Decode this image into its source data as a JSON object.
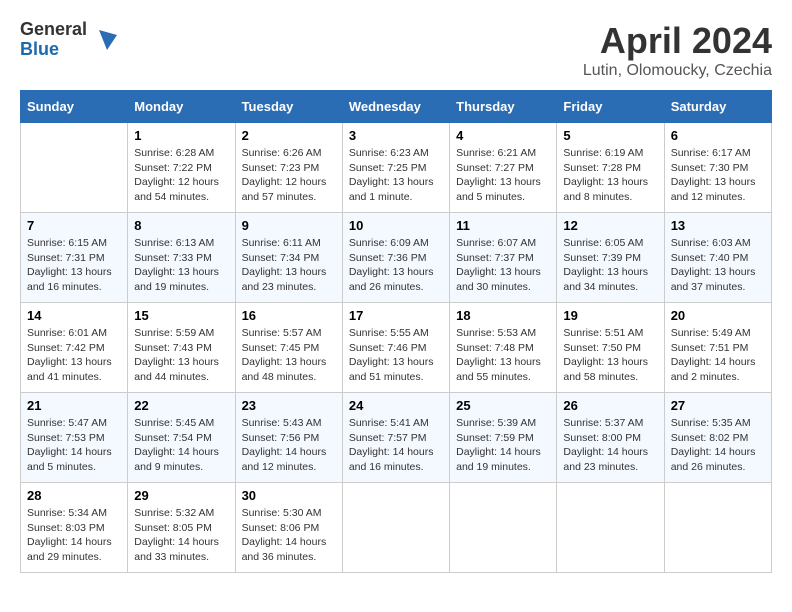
{
  "header": {
    "logo_general": "General",
    "logo_blue": "Blue",
    "month_title": "April 2024",
    "subtitle": "Lutin, Olomoucky, Czechia"
  },
  "calendar": {
    "days_of_week": [
      "Sunday",
      "Monday",
      "Tuesday",
      "Wednesday",
      "Thursday",
      "Friday",
      "Saturday"
    ],
    "weeks": [
      [
        {
          "day": "",
          "info": ""
        },
        {
          "day": "1",
          "info": "Sunrise: 6:28 AM\nSunset: 7:22 PM\nDaylight: 12 hours\nand 54 minutes."
        },
        {
          "day": "2",
          "info": "Sunrise: 6:26 AM\nSunset: 7:23 PM\nDaylight: 12 hours\nand 57 minutes."
        },
        {
          "day": "3",
          "info": "Sunrise: 6:23 AM\nSunset: 7:25 PM\nDaylight: 13 hours\nand 1 minute."
        },
        {
          "day": "4",
          "info": "Sunrise: 6:21 AM\nSunset: 7:27 PM\nDaylight: 13 hours\nand 5 minutes."
        },
        {
          "day": "5",
          "info": "Sunrise: 6:19 AM\nSunset: 7:28 PM\nDaylight: 13 hours\nand 8 minutes."
        },
        {
          "day": "6",
          "info": "Sunrise: 6:17 AM\nSunset: 7:30 PM\nDaylight: 13 hours\nand 12 minutes."
        }
      ],
      [
        {
          "day": "7",
          "info": "Sunrise: 6:15 AM\nSunset: 7:31 PM\nDaylight: 13 hours\nand 16 minutes."
        },
        {
          "day": "8",
          "info": "Sunrise: 6:13 AM\nSunset: 7:33 PM\nDaylight: 13 hours\nand 19 minutes."
        },
        {
          "day": "9",
          "info": "Sunrise: 6:11 AM\nSunset: 7:34 PM\nDaylight: 13 hours\nand 23 minutes."
        },
        {
          "day": "10",
          "info": "Sunrise: 6:09 AM\nSunset: 7:36 PM\nDaylight: 13 hours\nand 26 minutes."
        },
        {
          "day": "11",
          "info": "Sunrise: 6:07 AM\nSunset: 7:37 PM\nDaylight: 13 hours\nand 30 minutes."
        },
        {
          "day": "12",
          "info": "Sunrise: 6:05 AM\nSunset: 7:39 PM\nDaylight: 13 hours\nand 34 minutes."
        },
        {
          "day": "13",
          "info": "Sunrise: 6:03 AM\nSunset: 7:40 PM\nDaylight: 13 hours\nand 37 minutes."
        }
      ],
      [
        {
          "day": "14",
          "info": "Sunrise: 6:01 AM\nSunset: 7:42 PM\nDaylight: 13 hours\nand 41 minutes."
        },
        {
          "day": "15",
          "info": "Sunrise: 5:59 AM\nSunset: 7:43 PM\nDaylight: 13 hours\nand 44 minutes."
        },
        {
          "day": "16",
          "info": "Sunrise: 5:57 AM\nSunset: 7:45 PM\nDaylight: 13 hours\nand 48 minutes."
        },
        {
          "day": "17",
          "info": "Sunrise: 5:55 AM\nSunset: 7:46 PM\nDaylight: 13 hours\nand 51 minutes."
        },
        {
          "day": "18",
          "info": "Sunrise: 5:53 AM\nSunset: 7:48 PM\nDaylight: 13 hours\nand 55 minutes."
        },
        {
          "day": "19",
          "info": "Sunrise: 5:51 AM\nSunset: 7:50 PM\nDaylight: 13 hours\nand 58 minutes."
        },
        {
          "day": "20",
          "info": "Sunrise: 5:49 AM\nSunset: 7:51 PM\nDaylight: 14 hours\nand 2 minutes."
        }
      ],
      [
        {
          "day": "21",
          "info": "Sunrise: 5:47 AM\nSunset: 7:53 PM\nDaylight: 14 hours\nand 5 minutes."
        },
        {
          "day": "22",
          "info": "Sunrise: 5:45 AM\nSunset: 7:54 PM\nDaylight: 14 hours\nand 9 minutes."
        },
        {
          "day": "23",
          "info": "Sunrise: 5:43 AM\nSunset: 7:56 PM\nDaylight: 14 hours\nand 12 minutes."
        },
        {
          "day": "24",
          "info": "Sunrise: 5:41 AM\nSunset: 7:57 PM\nDaylight: 14 hours\nand 16 minutes."
        },
        {
          "day": "25",
          "info": "Sunrise: 5:39 AM\nSunset: 7:59 PM\nDaylight: 14 hours\nand 19 minutes."
        },
        {
          "day": "26",
          "info": "Sunrise: 5:37 AM\nSunset: 8:00 PM\nDaylight: 14 hours\nand 23 minutes."
        },
        {
          "day": "27",
          "info": "Sunrise: 5:35 AM\nSunset: 8:02 PM\nDaylight: 14 hours\nand 26 minutes."
        }
      ],
      [
        {
          "day": "28",
          "info": "Sunrise: 5:34 AM\nSunset: 8:03 PM\nDaylight: 14 hours\nand 29 minutes."
        },
        {
          "day": "29",
          "info": "Sunrise: 5:32 AM\nSunset: 8:05 PM\nDaylight: 14 hours\nand 33 minutes."
        },
        {
          "day": "30",
          "info": "Sunrise: 5:30 AM\nSunset: 8:06 PM\nDaylight: 14 hours\nand 36 minutes."
        },
        {
          "day": "",
          "info": ""
        },
        {
          "day": "",
          "info": ""
        },
        {
          "day": "",
          "info": ""
        },
        {
          "day": "",
          "info": ""
        }
      ]
    ]
  }
}
